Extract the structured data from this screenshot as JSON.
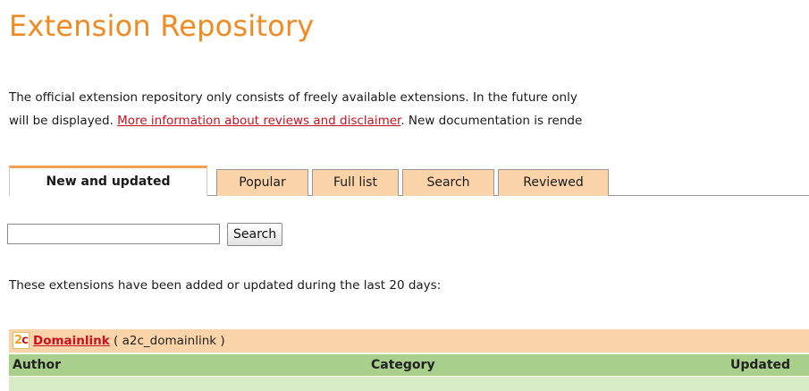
{
  "page": {
    "title": "Extension Repository"
  },
  "intro": {
    "line1": "The official extension repository only consists of freely available extensions. In the future only",
    "line2_before": "will be displayed. ",
    "line2_link": "More information about reviews and disclaimer",
    "line2_after": ". New documentation is rende"
  },
  "tabs": [
    {
      "label": "New and updated",
      "active": true
    },
    {
      "label": "Popular",
      "active": false
    },
    {
      "label": "Full list",
      "active": false
    },
    {
      "label": "Search",
      "active": false
    },
    {
      "label": "Reviewed",
      "active": false
    }
  ],
  "search": {
    "value": "",
    "button_label": "Search"
  },
  "listing": {
    "subtitle": "These extensions have been added or updated during the last 20 days:"
  },
  "extension": {
    "icon": "a2c-logo-icon",
    "logo_text_1": "2",
    "logo_text_2": "c",
    "name": "Domainlink",
    "key_text": " ( a2c_domainlink )",
    "columns": {
      "author": "Author",
      "category": "Category",
      "updated": "Updated"
    }
  },
  "colors": {
    "title": "#f08a24",
    "link": "#c8101f",
    "tab_bg": "#fbd3a8",
    "table_header": "#a9cf8c",
    "table_row": "#d6ebc6"
  }
}
